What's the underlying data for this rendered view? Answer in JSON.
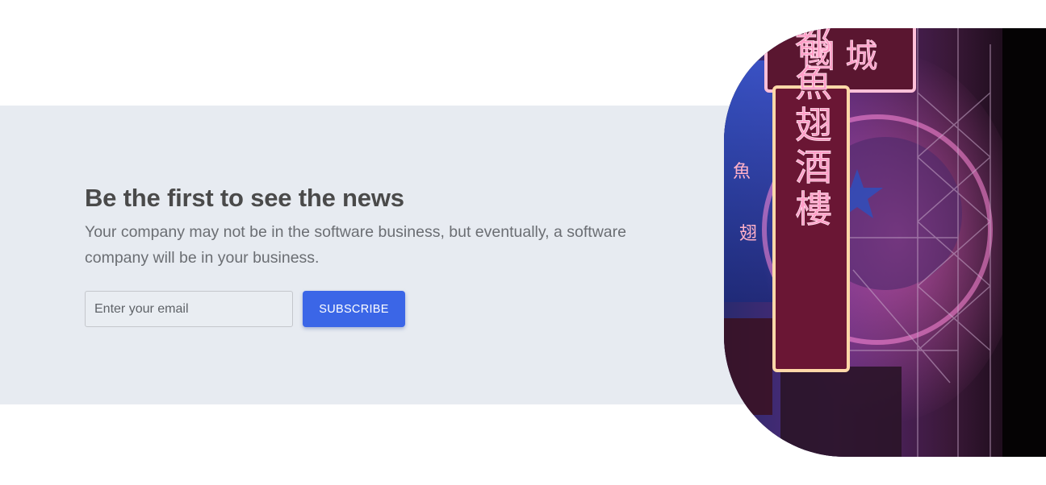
{
  "newsletter": {
    "heading": "Be the first to see the news",
    "description": "Your company may not be in the software business, but eventually, a software company will be in your business.",
    "email_placeholder": "Enter your email",
    "subscribe_label": "SUBSCRIBE"
  },
  "image": {
    "subject": "neon-sign-photo",
    "sign_text": "銀都魚翅酒樓",
    "top_sign_text": "國 城",
    "side_sign_text": [
      "魚",
      "翅"
    ]
  },
  "colors": {
    "band_background": "#e7ebf1",
    "accent": "#3b66e7",
    "heading": "#4a4a4a",
    "body_text": "#6b6e73"
  }
}
